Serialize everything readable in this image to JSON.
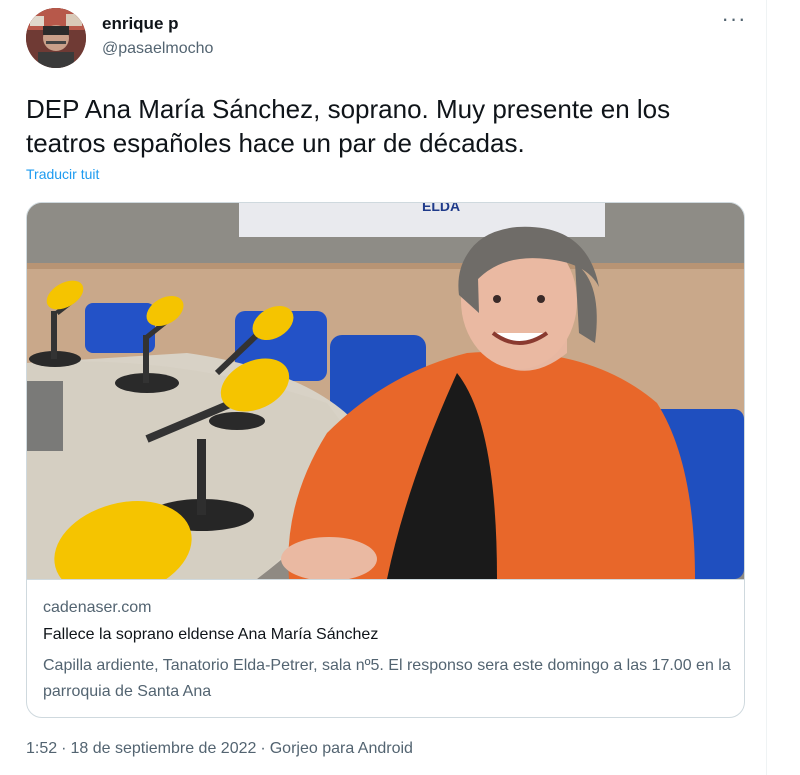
{
  "author": {
    "name": "enrique p",
    "handle": "@pasaelmocho"
  },
  "tweet": {
    "text": "DEP Ana María Sánchez, soprano. Muy presente en los teatros españoles hace un par de décadas.",
    "translate_label": "Traducir tuit",
    "more_label": "···"
  },
  "card": {
    "image_sign_text": "ELDA",
    "domain": "cadenaser.com",
    "title": "Fallece la soprano eldense Ana María Sánchez",
    "description": "Capilla ardiente, Tanatorio Elda-Petrer, sala nº5. El responso sera este domingo a las 17.00 en la parroquia de Santa Ana"
  },
  "meta": {
    "time": "1:52",
    "date": "18 de septiembre de 2022",
    "separator": "·",
    "source": "Gorjeo para Android"
  },
  "colors": {
    "link": "#1d9bf0",
    "secondary_text": "#536471",
    "border": "#cfd9de",
    "orange_cardigan": "#e8672a",
    "mic_yellow": "#f5c400",
    "chair_blue": "#1f4fbf"
  }
}
